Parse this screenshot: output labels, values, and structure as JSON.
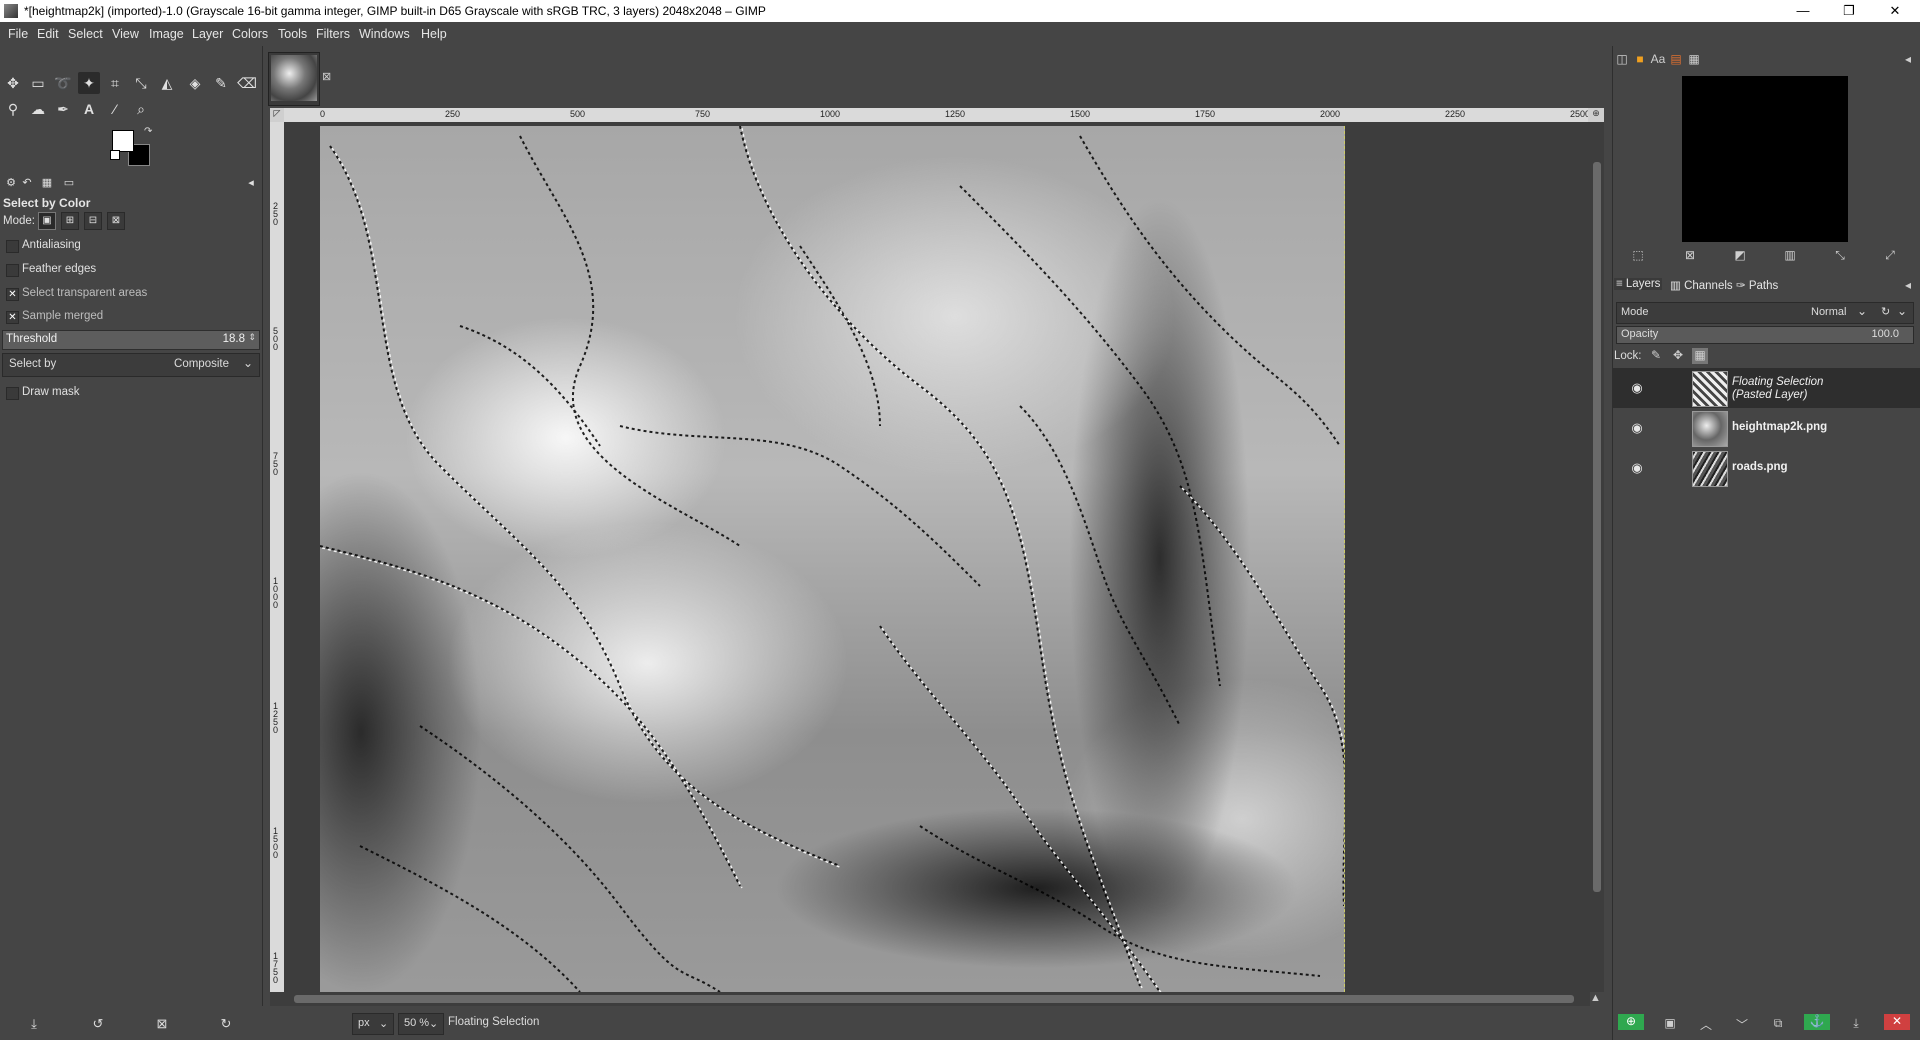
{
  "window": {
    "title": "*[heightmap2k] (imported)-1.0 (Grayscale 16-bit gamma integer, GIMP built-in D65 Grayscale with sRGB TRC, 3 layers) 2048x2048 – GIMP",
    "minimize": "—",
    "maximize": "❐",
    "close": "✕"
  },
  "menu": [
    "File",
    "Edit",
    "Select",
    "View",
    "Image",
    "Layer",
    "Colors",
    "Tools",
    "Filters",
    "Windows",
    "Help"
  ],
  "toolbox": {
    "tools": [
      "move-icon",
      "rect-select-icon",
      "lasso-icon",
      "fuzzy-select-icon",
      "crop-icon",
      "transform-icon",
      "warp-icon",
      "bucket-fill-icon",
      "paintbrush-icon",
      "eraser-icon",
      "clone-icon",
      "smudge-icon",
      "path-icon",
      "text-icon",
      "color-picker-icon",
      "zoom-icon"
    ]
  },
  "tool_options": {
    "title": "Select by Color",
    "mode_label": "Mode:",
    "antialiasing": {
      "label": "Antialiasing",
      "checked": false
    },
    "feather": {
      "label": "Feather edges",
      "checked": false
    },
    "transparent": {
      "label": "Select transparent areas",
      "checked": true
    },
    "sample_merged": {
      "label": "Sample merged",
      "checked": true
    },
    "threshold": {
      "label": "Threshold",
      "value": "18.8"
    },
    "select_by": {
      "label": "Select by",
      "value": "Composite"
    },
    "draw_mask": {
      "label": "Draw mask",
      "checked": false
    }
  },
  "ruler": {
    "h_ticks": [
      "0",
      "250",
      "500",
      "750",
      "1000",
      "1250",
      "1500",
      "1750",
      "2000",
      "2250",
      "2500"
    ],
    "v_ticks": [
      "2\n5\n0",
      "5\n0\n0",
      "7\n5\n0",
      "1\n0\n0\n0",
      "1\n2\n5\n0",
      "1\n5\n0\n0",
      "1\n7\n5\n0"
    ]
  },
  "statusbar": {
    "unit": "px",
    "zoom": "50 %",
    "message": "Floating Selection"
  },
  "layers_panel": {
    "tabs": [
      "Layers",
      "Channels",
      "Paths"
    ],
    "mode_label": "Mode",
    "mode_value": "Normal",
    "opacity_label": "Opacity",
    "opacity_value": "100.0",
    "lock_label": "Lock:",
    "layers": [
      {
        "name": "Floating Selection\n(Pasted Layer)",
        "italic": true,
        "selected": true
      },
      {
        "name": "heightmap2k.png",
        "italic": false,
        "selected": false
      },
      {
        "name": "roads.png",
        "italic": false,
        "selected": false
      }
    ]
  },
  "colors": {
    "fg": "#ffffff",
    "bg": "#000000",
    "accent": "#2fa84f"
  }
}
